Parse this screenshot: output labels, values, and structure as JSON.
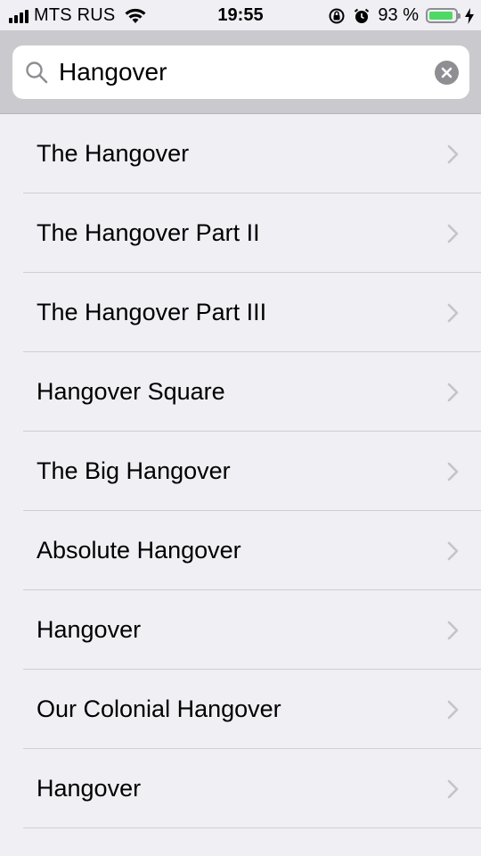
{
  "status_bar": {
    "carrier": "MTS RUS",
    "time": "19:55",
    "battery_percent_text": "93 %",
    "battery_level": 0.93,
    "battery_color": "#4cd964",
    "signal_bars": 4,
    "icons": [
      "signal-icon",
      "wifi-icon",
      "orientation-lock-icon",
      "alarm-icon",
      "battery-icon",
      "charging-icon"
    ]
  },
  "search": {
    "value": "Hangover",
    "icon": "search-icon",
    "clear_icon": "clear-icon"
  },
  "results": [
    {
      "title": "The Hangover"
    },
    {
      "title": "The Hangover Part II"
    },
    {
      "title": "The Hangover Part III"
    },
    {
      "title": "Hangover Square"
    },
    {
      "title": "The Big Hangover"
    },
    {
      "title": "Absolute Hangover"
    },
    {
      "title": "Hangover"
    },
    {
      "title": "Our Colonial Hangover"
    },
    {
      "title": "Hangover"
    }
  ]
}
